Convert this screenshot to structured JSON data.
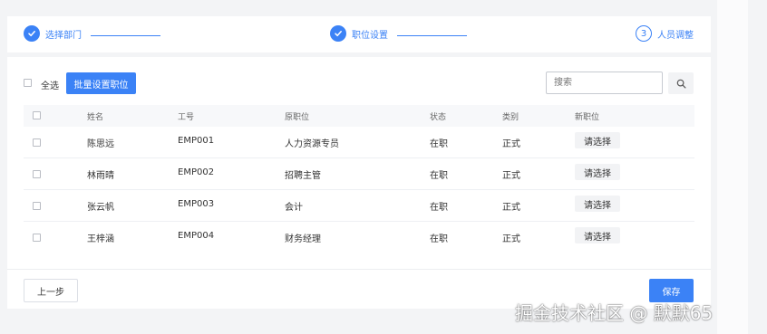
{
  "steps": [
    {
      "label": "选择部门",
      "state": "done",
      "icon": "check-icon"
    },
    {
      "label": "职位设置",
      "state": "done",
      "icon": "check-icon"
    },
    {
      "label": "人员调整",
      "state": "current",
      "number": "3"
    }
  ],
  "toolbar": {
    "select_all_label": "全选",
    "batch_button_label": "批量设置职位",
    "search_placeholder": "搜索",
    "search_icon": "search-icon"
  },
  "table": {
    "headers": [
      "姓名",
      "工号",
      "原职位",
      "状态",
      "类别",
      "新职位"
    ],
    "rows": [
      {
        "name": "陈思远",
        "id": "EMP001",
        "old_position": "人力资源专员",
        "status": "在职",
        "type": "正式",
        "new_position": "请选择"
      },
      {
        "name": "林雨晴",
        "id": "EMP002",
        "old_position": "招聘主管",
        "status": "在职",
        "type": "正式",
        "new_position": "请选择"
      },
      {
        "name": "张云帆",
        "id": "EMP003",
        "old_position": "会计",
        "status": "在职",
        "type": "正式",
        "new_position": "请选择"
      },
      {
        "name": "王梓涵",
        "id": "EMP004",
        "old_position": "财务经理",
        "status": "在职",
        "type": "正式",
        "new_position": "请选择"
      }
    ]
  },
  "footer": {
    "prev_label": "上一步",
    "save_label": "保存"
  },
  "watermark": "掘金技术社区 @ 默默65",
  "colors": {
    "primary": "#3b82f6",
    "header_bg": "#f7f8fa",
    "page_bg": "#f3f4f6"
  }
}
